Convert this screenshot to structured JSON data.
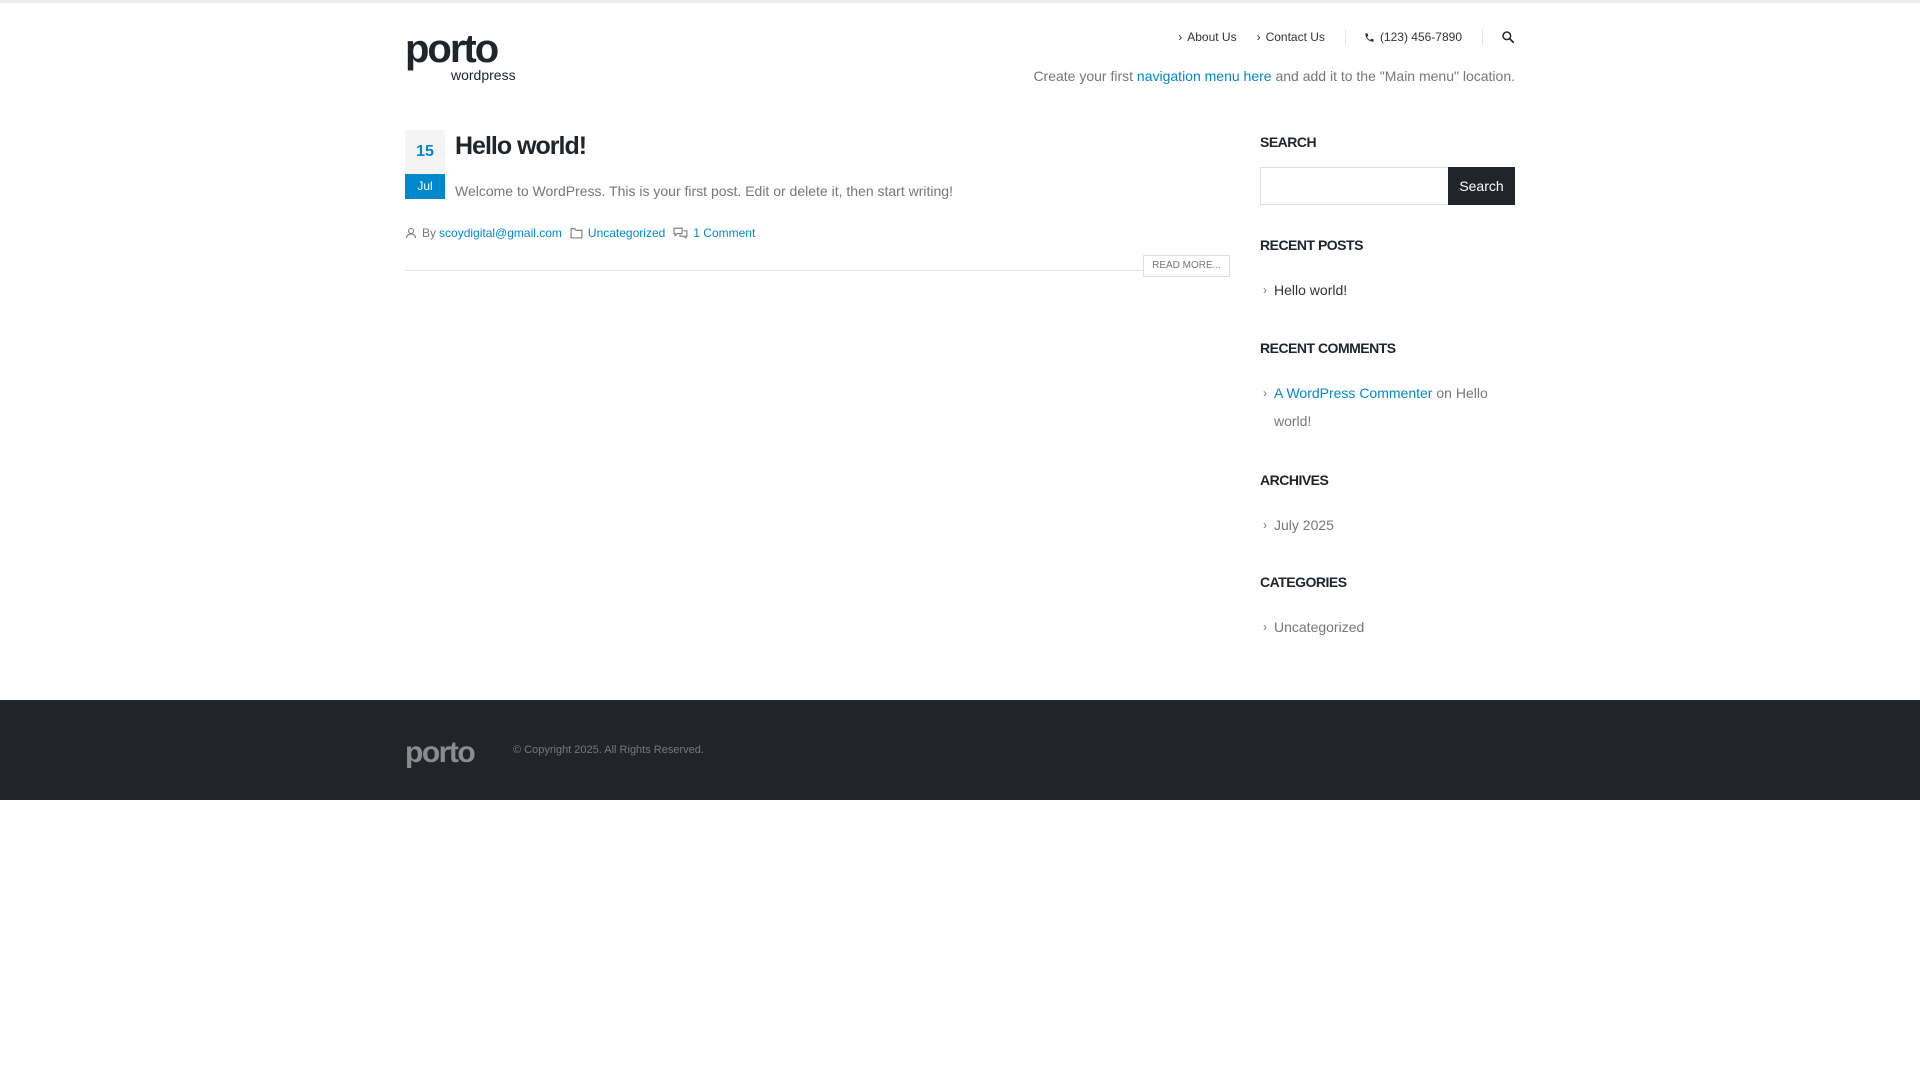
{
  "header": {
    "top_links": [
      {
        "label": "About Us"
      },
      {
        "label": "Contact Us"
      }
    ],
    "phone": "(123) 456-7890",
    "nav_hint_before": "Create your first ",
    "nav_hint_link": "navigation menu here",
    "nav_hint_after": " and add it to the \"Main menu\" location.",
    "logo": {
      "main": "porto",
      "sub": "wordpress"
    }
  },
  "post": {
    "day": "15",
    "month": "Jul",
    "title": "Hello world!",
    "excerpt": "Welcome to WordPress. This is your first post. Edit or delete it, then start writing!",
    "by_label": "By",
    "author": "scoydigital@gmail.com",
    "category": "Uncategorized",
    "comments": "1 Comment",
    "read_more": "READ MORE..."
  },
  "sidebar": {
    "search_title": "SEARCH",
    "search_button": "Search",
    "search_value": "",
    "recent_posts_title": "RECENT POSTS",
    "recent_posts": [
      "Hello world!"
    ],
    "recent_comments_title": "RECENT COMMENTS",
    "comment_author": "A WordPress Commenter",
    "comment_on": " on ",
    "comment_post": "Hello world!",
    "archives_title": "ARCHIVES",
    "archives": [
      "July 2025"
    ],
    "categories_title": "CATEGORIES",
    "categories": [
      "Uncategorized"
    ]
  },
  "footer": {
    "logo": "porto",
    "copyright": "© Copyright 2025. All Rights Reserved."
  },
  "icons": {
    "chevron": "chevron-right-icon",
    "phone": "phone-icon",
    "search": "search-icon",
    "user": "user-icon",
    "folder": "folder-icon",
    "comments": "comments-icon"
  },
  "colors": {
    "accent": "#0088cc",
    "dark": "#212529",
    "text": "#777777"
  }
}
